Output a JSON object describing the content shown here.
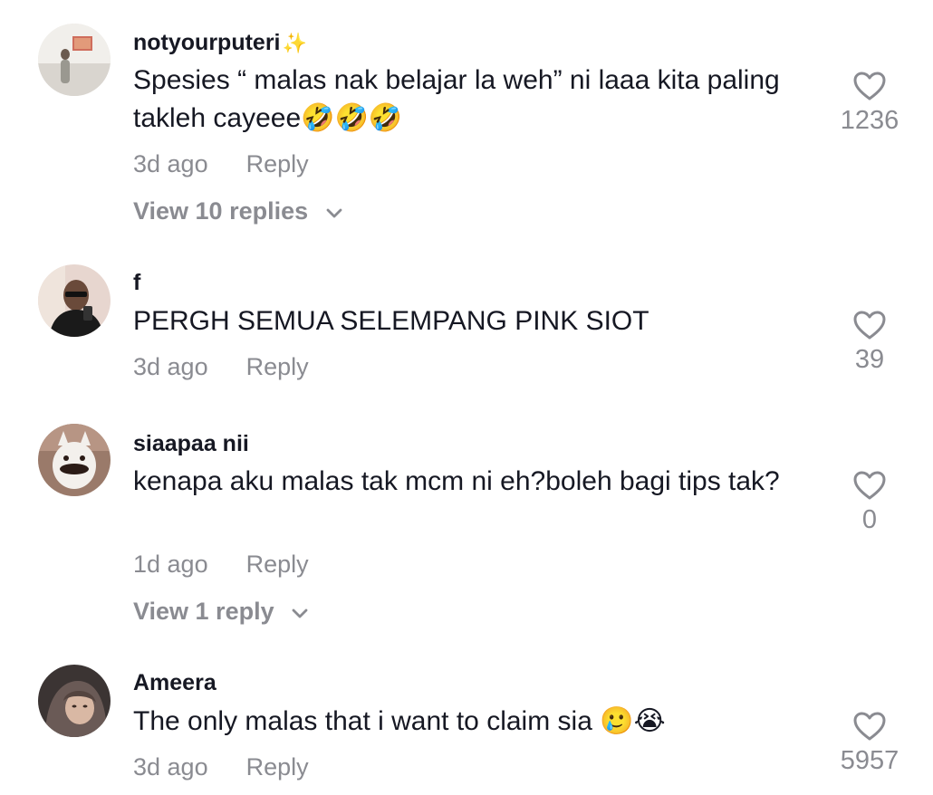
{
  "comments": [
    {
      "username": "notyourputeri",
      "username_suffix": "✨",
      "text": "Spesies “ malas nak belajar la weh” ni laaa kita paling takleh cayeee🤣🤣🤣",
      "time": "3d ago",
      "reply_label": "Reply",
      "likes": "1236",
      "view_replies": "View 10 replies"
    },
    {
      "username": "f",
      "text": "PERGH SEMUA SELEMPANG PINK SIOT",
      "time": "3d ago",
      "reply_label": "Reply",
      "likes": "39"
    },
    {
      "username": "siaapaa nii",
      "text": "kenapa aku malas tak mcm ni eh?boleh bagi tips tak?",
      "time": "1d ago",
      "reply_label": "Reply",
      "likes": "0",
      "view_replies": "View 1 reply"
    },
    {
      "username": "Ameera",
      "text": "The only malas that i want to claim sia 🥲😭",
      "time": "3d ago",
      "reply_label": "Reply",
      "likes": "5957"
    }
  ],
  "icons": {
    "like": "heart-outline-icon",
    "expand": "chevron-down-icon"
  },
  "colors": {
    "primary_text": "#161823",
    "secondary_text": "#8a8b91",
    "sparkle": "#f2c230"
  }
}
